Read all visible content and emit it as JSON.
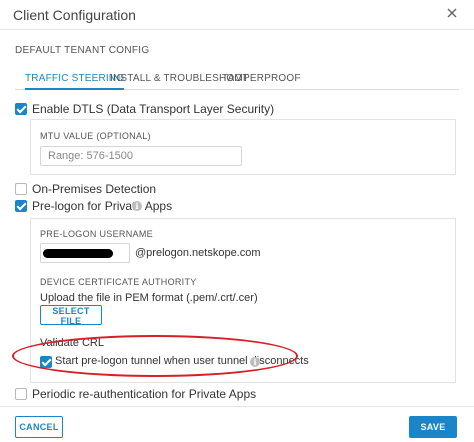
{
  "dialog": {
    "title": "Client Configuration",
    "subtitle": "DEFAULT TENANT CONFIG"
  },
  "tabs": [
    {
      "label": "TRAFFIC STEERING",
      "active": true
    },
    {
      "label": "INSTALL & TROUBLESHOOT",
      "active": false
    },
    {
      "label": "TAMPERPROOF",
      "active": false
    }
  ],
  "settings": {
    "dtls": {
      "label": "Enable DTLS (Data Transport Layer Security)",
      "checked": true
    },
    "mtu": {
      "label": "MTU VALUE (OPTIONAL)",
      "placeholder": "Range: 576-1500",
      "value": ""
    },
    "on_premises": {
      "label": "On-Premises Detection",
      "checked": false
    },
    "pre_logon": {
      "label": "Pre-logon for Private Apps",
      "checked": true
    },
    "username": {
      "label": "PRE-LOGON USERNAME",
      "suffix": "@prelogon.netskope.com"
    },
    "device_cert": {
      "label": "DEVICE CERTIFICATE AUTHORITY",
      "upload_text": "Upload the file in PEM format (.pem/.crt/.cer)",
      "button": "SELECT FILE"
    },
    "validate_crl": {
      "label": "Validate CRL"
    },
    "start_tunnel": {
      "label": "Start pre-logon tunnel when user tunnel disconnects",
      "checked": true
    },
    "periodic_reauth": {
      "label": "Periodic re-authentication for Private Apps",
      "checked": false
    }
  },
  "footer": {
    "cancel": "CANCEL",
    "save": "SAVE"
  },
  "colors": {
    "accent": "#1a86c7",
    "highlight": "#d61f26"
  },
  "icons": {
    "close": "close-icon",
    "info": "info-icon",
    "check": "checkmark-icon"
  }
}
